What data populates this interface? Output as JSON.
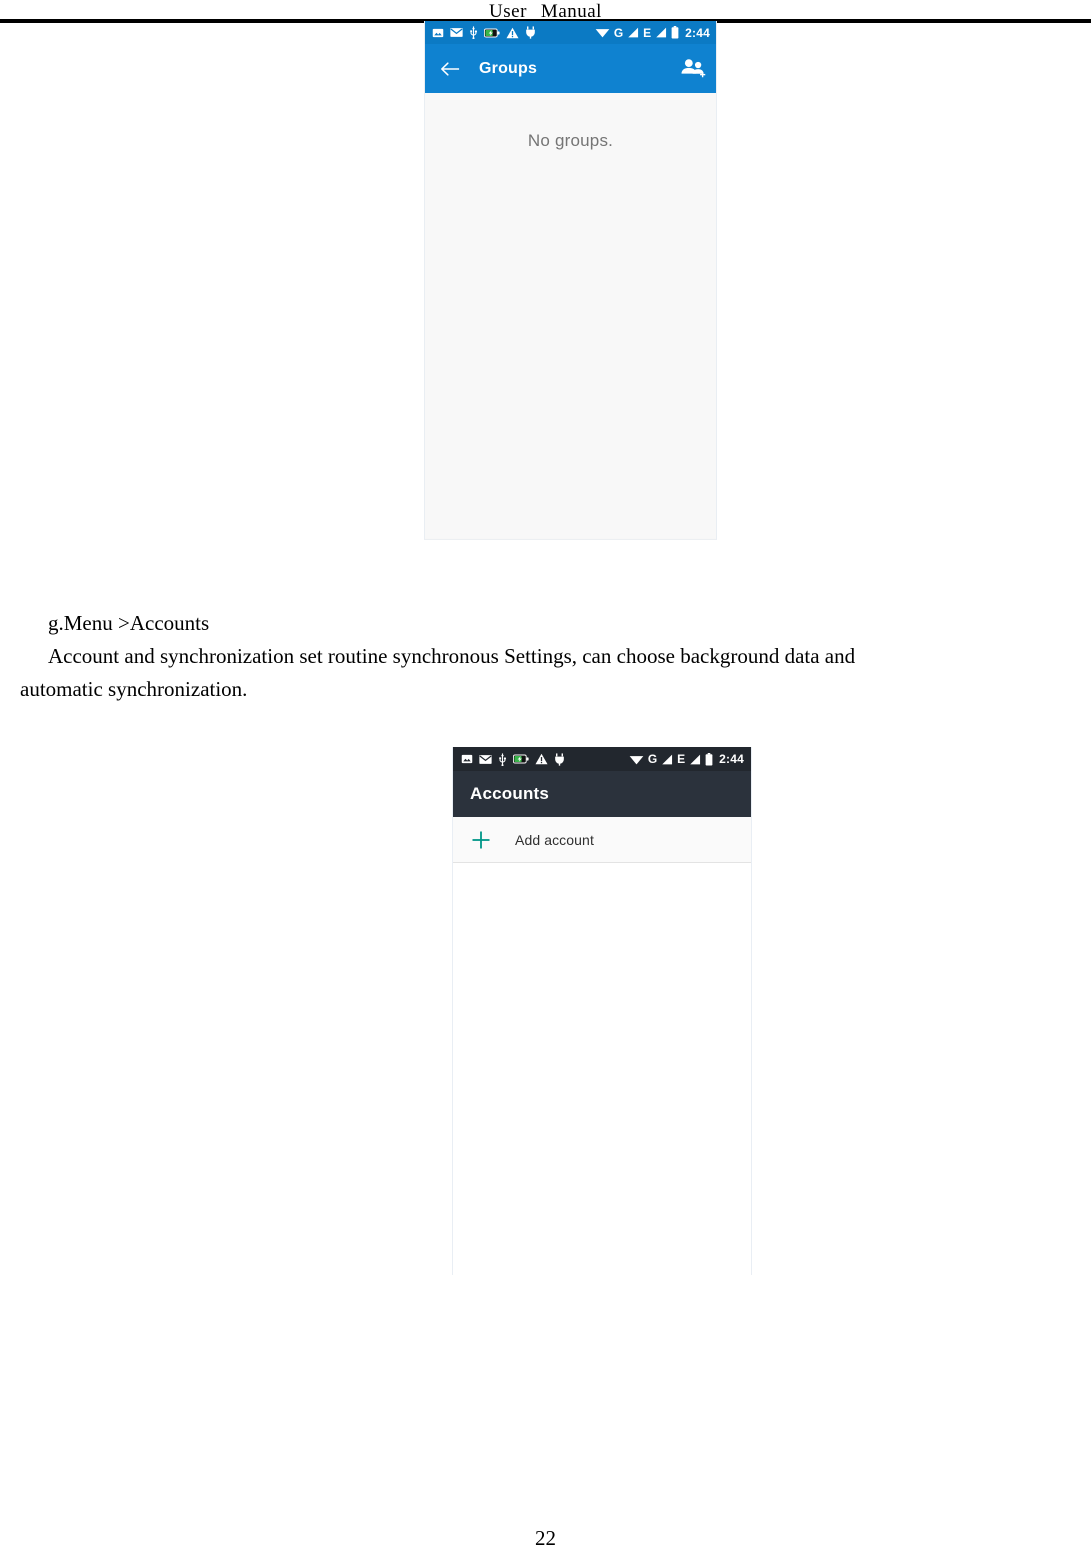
{
  "document": {
    "header_left_word": "User",
    "header_right_word": "Manual",
    "page_number": "22",
    "paragraphs": {
      "heading": "g.Menu >Accounts",
      "body_main": "Account and synchronization set routine synchronous Settings, can choose background data and",
      "body_last": "automatic synchronization."
    }
  },
  "screenshot_groups": {
    "statusbar": {
      "icons_left": [
        "image-icon",
        "email-icon",
        "usb-icon",
        "battery-charging-icon",
        "warning-icon",
        "usb-debug-icon"
      ],
      "wifi_icon": "wifi-icon",
      "sim1_label": "G",
      "sim1_signal_icon": "signal-bars-icon",
      "sim2_label": "E",
      "sim2_signal_icon": "signal-bars-icon",
      "battery_icon": "battery-icon",
      "time": "2:44"
    },
    "appbar": {
      "back_icon": "back-arrow-icon",
      "title": "Groups",
      "action_icon": "add-group-icon",
      "bg_color": "#0f82d0"
    },
    "body": {
      "empty_message": "No groups."
    }
  },
  "screenshot_accounts": {
    "statusbar": {
      "icons_left": [
        "image-icon",
        "email-icon",
        "usb-icon",
        "battery-charging-icon",
        "warning-icon",
        "usb-debug-icon"
      ],
      "wifi_icon": "wifi-icon",
      "sim1_label": "G",
      "sim1_signal_icon": "signal-bars-icon",
      "sim2_label": "E",
      "sim2_signal_icon": "signal-bars-icon",
      "battery_icon": "battery-icon",
      "time": "2:44"
    },
    "appbar": {
      "title": "Accounts",
      "bg_color": "#2b323c"
    },
    "rows": [
      {
        "icon": "plus-icon",
        "icon_color": "#009688",
        "label": "Add account"
      }
    ]
  }
}
